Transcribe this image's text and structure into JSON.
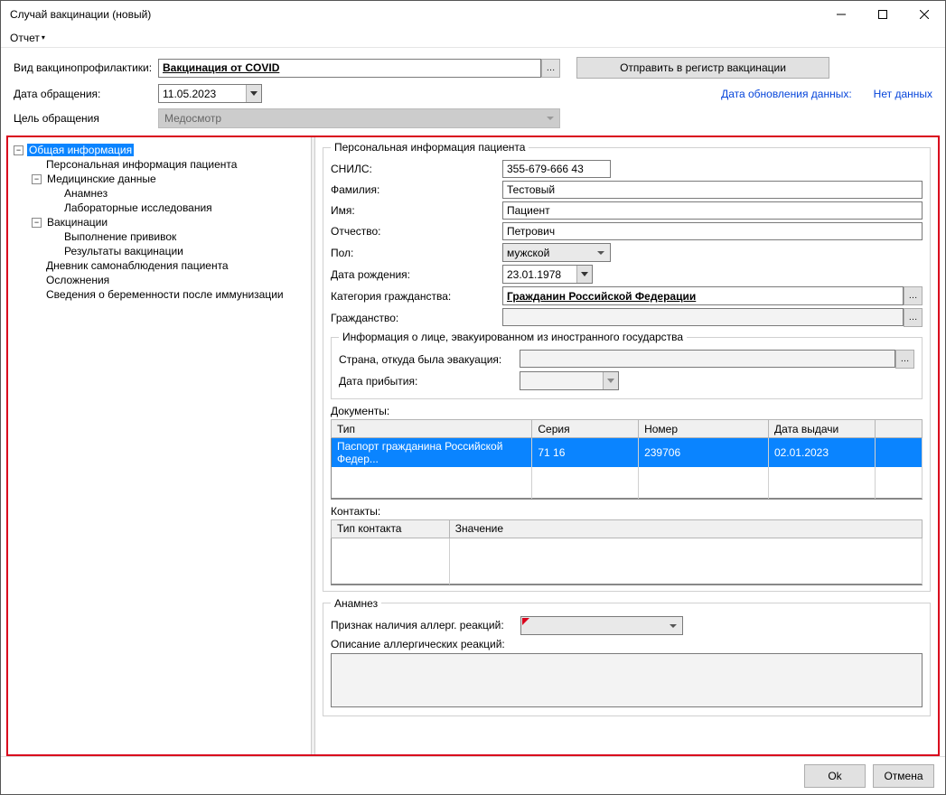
{
  "window": {
    "title": "Случай вакцинации (новый)"
  },
  "menu": {
    "report": "Отчет"
  },
  "top": {
    "type_label": "Вид вакцинопрофилактики:",
    "type_value": "Вакцинация от COVID",
    "send_btn": "Отправить в регистр вакцинации",
    "date_label": "Дата обращения:",
    "date_value": "11.05.2023",
    "update_label": "Дата обновления данных:",
    "update_value": "Нет данных",
    "purpose_label": "Цель обращения",
    "purpose_value": "Медосмотр"
  },
  "tree": {
    "n0": "Общая информация",
    "n1": "Персональная информация пациента",
    "n2": "Медицинские данные",
    "n3": "Анамнез",
    "n4": "Лабораторные исследования",
    "n5": "Вакцинации",
    "n6": "Выполнение прививок",
    "n7": "Результаты вакцинации",
    "n8": "Дневник самонаблюдения пациента",
    "n9": "Осложнения",
    "n10": "Сведения о беременности после иммунизации"
  },
  "personal": {
    "legend": "Персональная информация пациента",
    "snils_label": "СНИЛС:",
    "snils_value": "355-679-666 43",
    "fam_label": "Фамилия:",
    "fam_value": "Тестовый",
    "name_label": "Имя:",
    "name_value": "Пациент",
    "patr_label": "Отчество:",
    "patr_value": "Петрович",
    "sex_label": "Пол:",
    "sex_value": "мужской",
    "dob_label": "Дата рождения:",
    "dob_value": "23.01.1978",
    "citcat_label": "Категория гражданства:",
    "citcat_value": "Гражданин Российской Федерации",
    "cit_label": "Гражданство:"
  },
  "evac": {
    "legend": "Информация о лице, эвакуированном из иностранного государства",
    "country_label": "Страна, откуда была эвакуация:",
    "arrive_label": "Дата прибытия:"
  },
  "docs": {
    "label": "Документы:",
    "h_type": "Тип",
    "h_series": "Серия",
    "h_num": "Номер",
    "h_date": "Дата выдачи",
    "row": {
      "type": "Паспорт гражданина Российской Федер...",
      "series": "71 16",
      "num": "239706",
      "date": "02.01.2023"
    }
  },
  "contacts": {
    "label": "Контакты:",
    "h_type": "Тип контакта",
    "h_val": "Значение"
  },
  "anamnesis": {
    "legend": "Анамнез",
    "allergy_flag_label": "Признак наличия аллерг. реакций:",
    "allergy_desc_label": "Описание аллергических реакций:"
  },
  "footer": {
    "ok": "Ok",
    "cancel": "Отмена"
  }
}
